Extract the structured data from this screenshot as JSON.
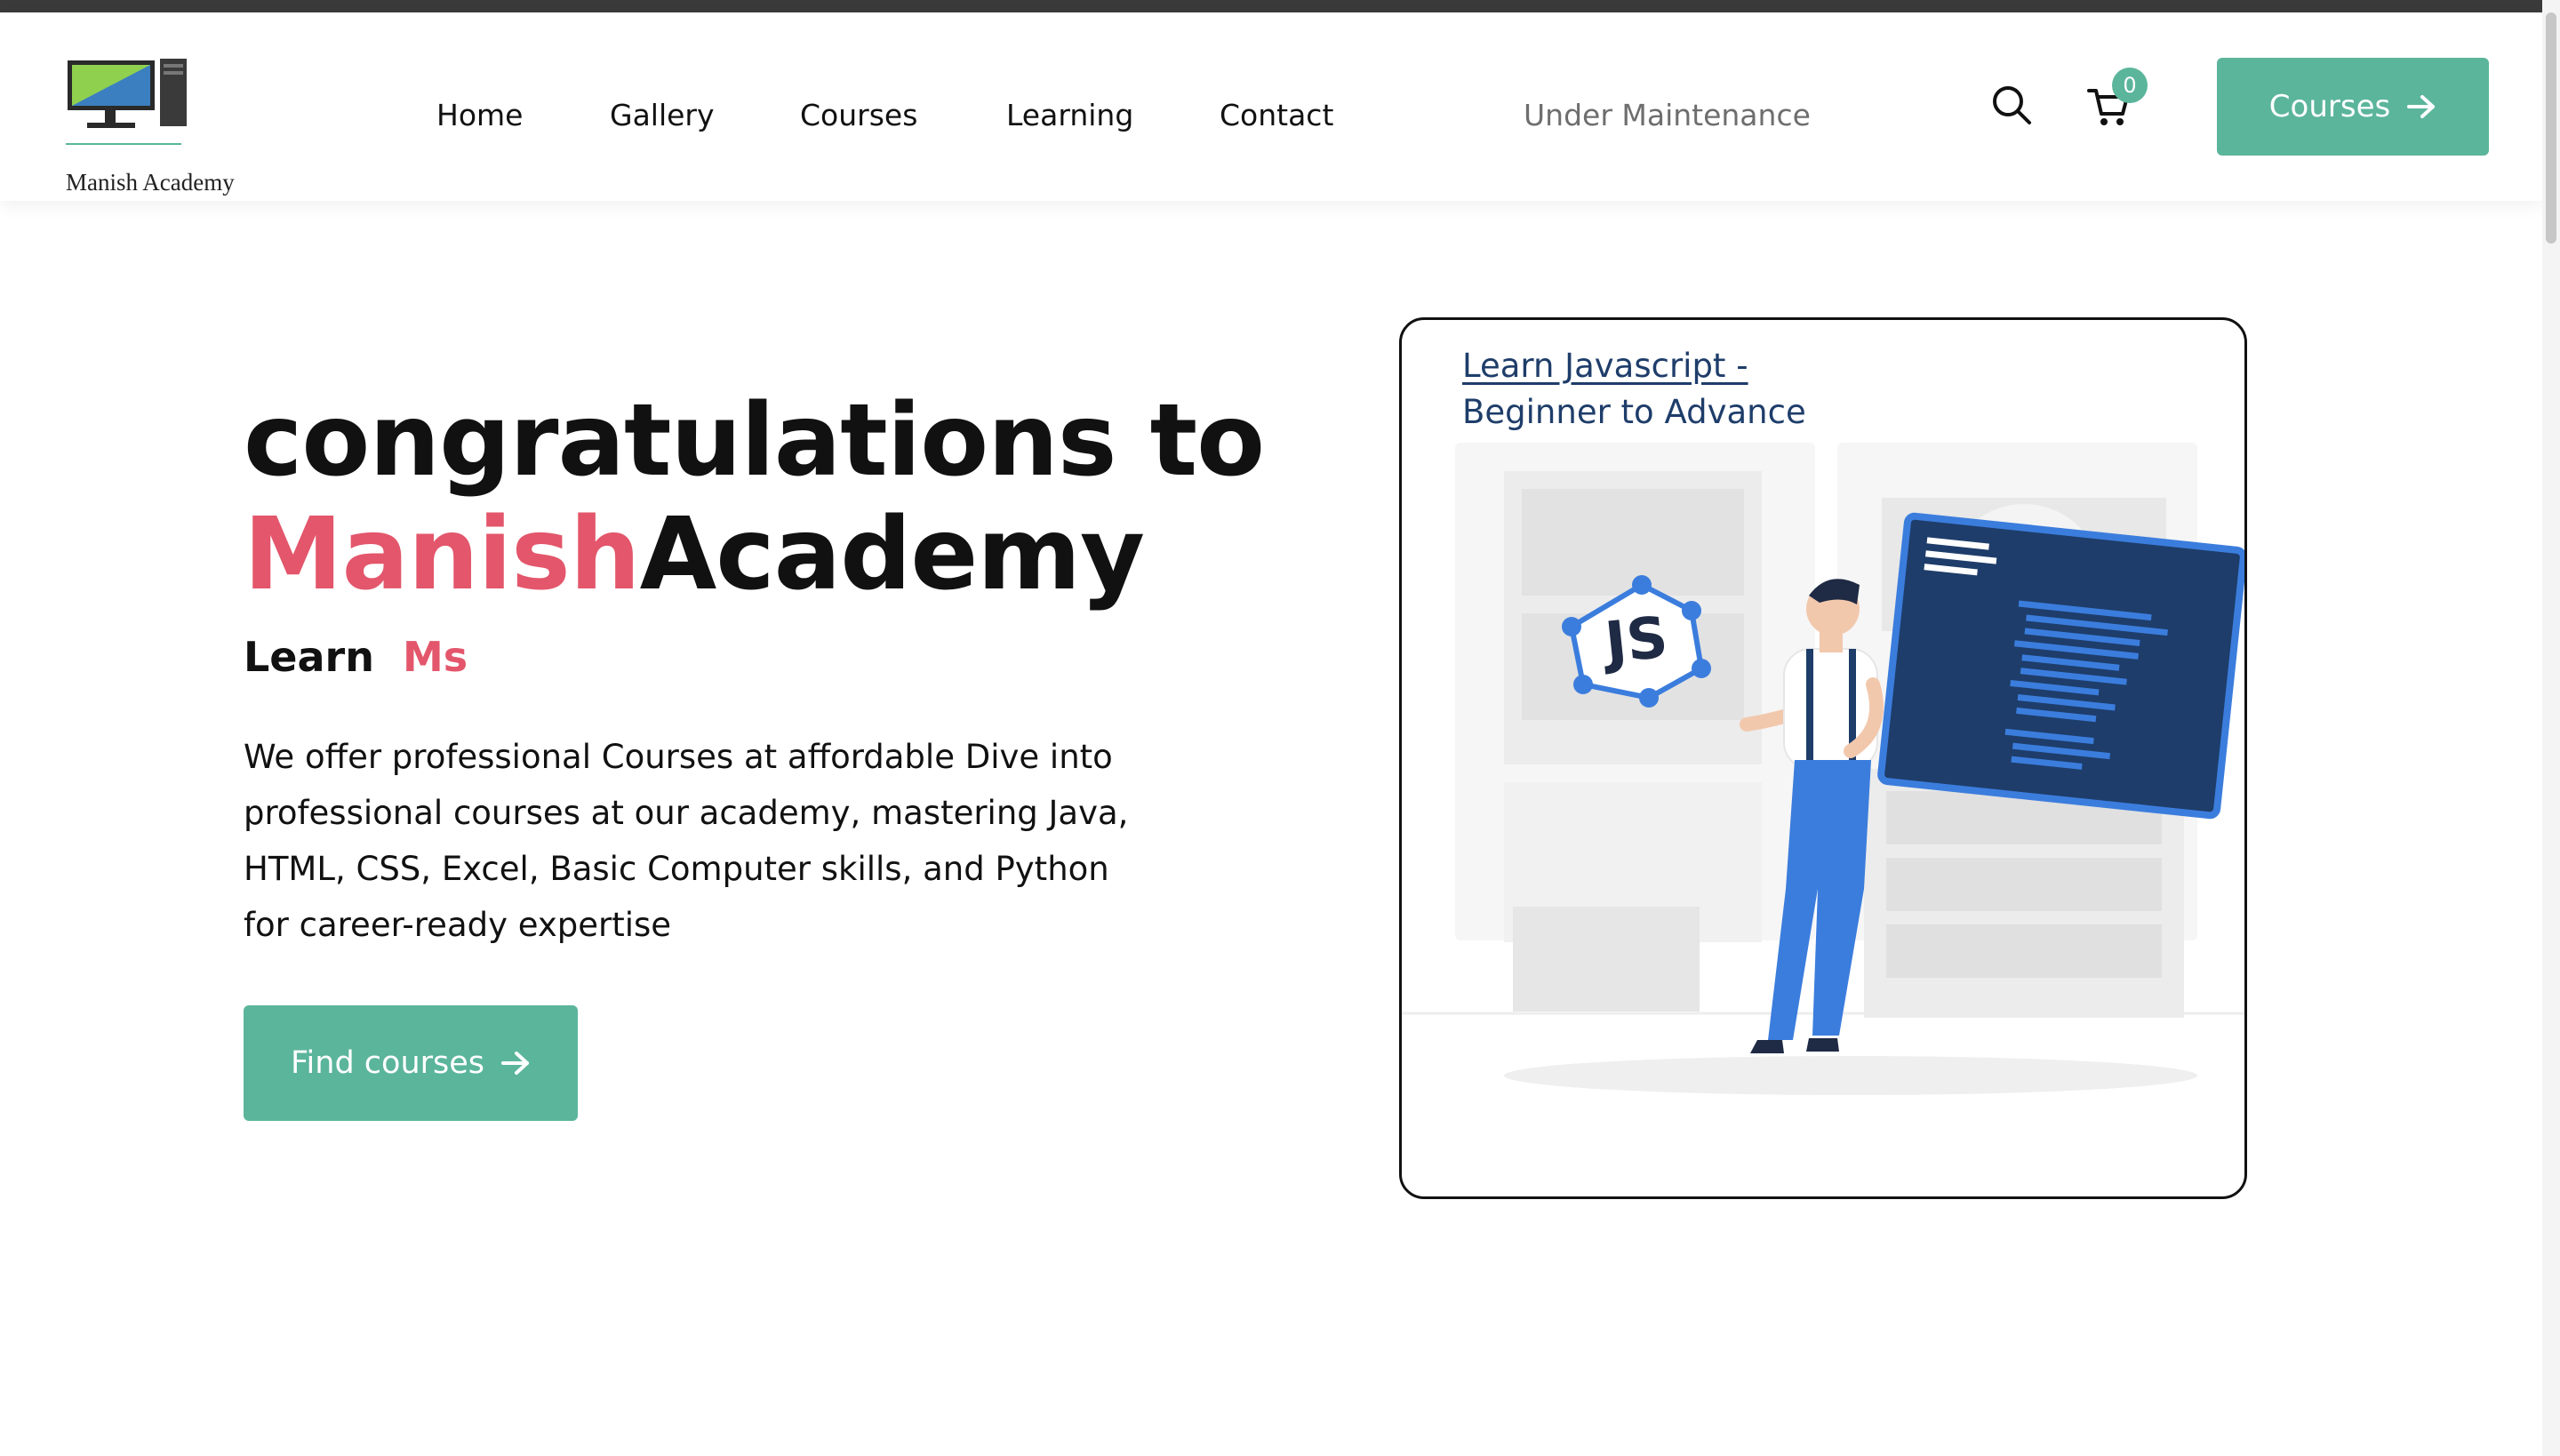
{
  "brand": {
    "name": "Manish Academy"
  },
  "nav": {
    "items": [
      {
        "label": "Home"
      },
      {
        "label": "Gallery"
      },
      {
        "label": "Courses"
      },
      {
        "label": "Learning"
      },
      {
        "label": "Contact"
      }
    ],
    "maintenance": "Under Maintenance"
  },
  "header": {
    "search_icon": "search-icon",
    "cart_icon": "cart-icon",
    "cart_count": "0",
    "cta_label": "Courses",
    "cta_icon": "arrow-right-icon"
  },
  "hero": {
    "title_line1": "congratulations to",
    "title_pink": "Manish",
    "title_rest": "Academy",
    "sub_prefix": "Learn",
    "sub_highlight": "Ms",
    "description": "We offer professional Courses at affordable Dive into professional courses at our academy, mastering Java, HTML, CSS, Excel, Basic Computer skills, and Python for career-ready expertise",
    "button_label": "Find courses"
  },
  "card": {
    "title_line1": "Learn Javascript -",
    "title_line2": "Beginner to Advance",
    "illustration_badge": "JS"
  },
  "colors": {
    "accent": "#5bb59b",
    "highlight": "#e3566b",
    "card_title": "#1e3d6a",
    "illus_blue": "#3b7ddd",
    "illus_navy": "#1e3d6a"
  }
}
